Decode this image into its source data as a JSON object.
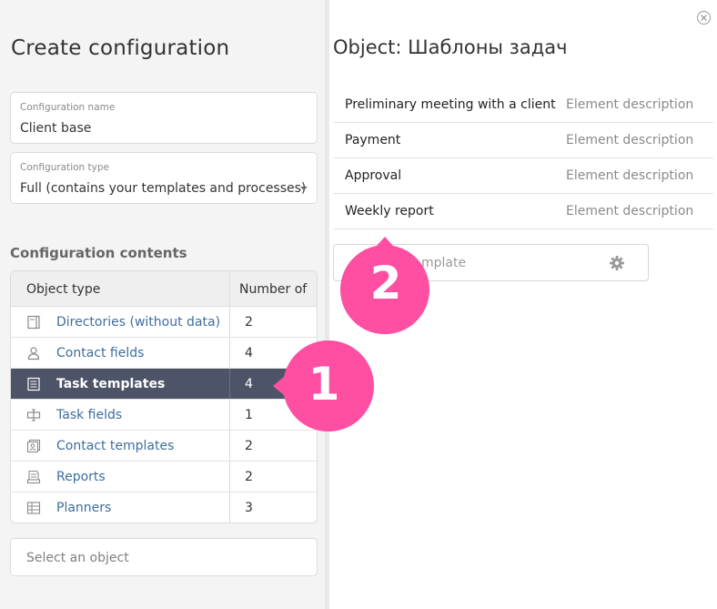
{
  "left": {
    "title": "Create configuration",
    "config_name": {
      "label": "Configuration name",
      "value": "Client base"
    },
    "config_type": {
      "label": "Configuration type",
      "value": "Full (contains your templates and processes)"
    },
    "contents_title": "Configuration contents",
    "table": {
      "headers": [
        "Object type",
        "Number of"
      ],
      "rows": [
        {
          "name": "Directories (without data)",
          "count": "2",
          "icon": "directory-icon"
        },
        {
          "name": "Contact fields",
          "count": "4",
          "icon": "contact-icon"
        },
        {
          "name": "Task templates",
          "count": "4",
          "icon": "task-template-icon",
          "selected": true
        },
        {
          "name": "Task fields",
          "count": "1",
          "icon": "task-field-icon"
        },
        {
          "name": "Contact templates",
          "count": "2",
          "icon": "contact-template-icon"
        },
        {
          "name": "Reports",
          "count": "2",
          "icon": "report-icon"
        },
        {
          "name": "Planners",
          "count": "3",
          "icon": "planner-icon"
        }
      ]
    },
    "select_placeholder": "Select an object"
  },
  "right": {
    "title": "Object: Шаблоны задач",
    "items": [
      {
        "name": "Preliminary meeting with a client",
        "description": "Element description"
      },
      {
        "name": "Payment",
        "description": "Element description"
      },
      {
        "name": "Approval",
        "description": "Element description"
      },
      {
        "name": "Weekly report",
        "description": "Element description"
      }
    ],
    "template_button_visible_text": "mplate"
  },
  "markers": {
    "one": "1",
    "two": "2"
  },
  "colors": {
    "selected_row": "#4e5468",
    "link": "#3d6e9e",
    "marker": "#ff4fa3"
  }
}
